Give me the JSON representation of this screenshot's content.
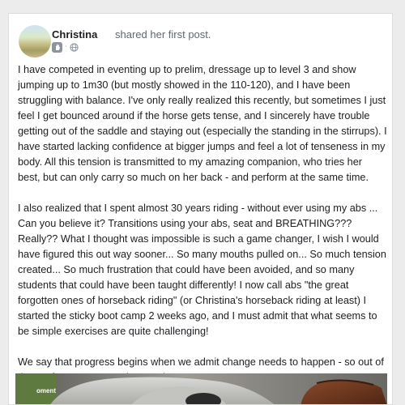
{
  "post": {
    "author": "Christina",
    "action": "shared her first post.",
    "icons": [
      "wave-badge-icon",
      "globe-icon"
    ],
    "paragraphs": [
      "I have competed in eventing up to prelim, dressage up to level 3 and show jumping up to 1m30 (but mostly showed in the 110-120), and I have been struggling with balance. I've only really realized this recently, but sometimes I just feel I get bounced around if the horse gets tense, and I sincerely have trouble getting out of the saddle and staying out (especially the standing in the stirrups). I have started lacking confidence at bigger jumps and feel a lot of tenseness in my body. All this tension is transmitted to my amazing companion, who tries her best, but can only carry so much on her back - and perform at the same time.",
      "I also realized that I spent almost 30 years riding - without ever using my abs ... Can you believe it? Transitions using your abs, seat and BREATHING??? Really?? What I thought was impossible is such a game changer, I wish I would have figured this out way sooner... So many mouths pulled on... So much tension created... So much frustration that could have been avoided, and so many students that could have been taught differently! I now call abs \"the great forgotten ones of horseback riding\" (or Christina's horseback riding at least) I started the sticky boot camp 2 weeks ago, and I must admit that what seems to be simple exercises are quite challenging!",
      "We say that progress begins when we admit change needs to happen - so out of the confort zone, up and onwards we go!!"
    ],
    "image": {
      "overlay_text": "oment"
    }
  },
  "colors": {
    "page_background": "#ececec",
    "card_background": "#ffffff",
    "text_primary": "#1c1e21",
    "text_secondary": "#606770",
    "icon_gray": "#8d949e"
  }
}
